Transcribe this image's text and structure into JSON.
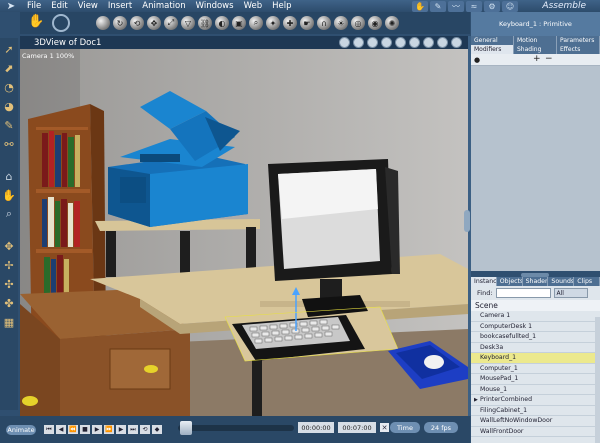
{
  "menubar": {
    "logo_icon": "poser-arrow-icon",
    "items": [
      "File",
      "Edit",
      "View",
      "Insert",
      "Animation",
      "Windows",
      "Web",
      "Help"
    ],
    "room": "Assemble"
  },
  "viewport": {
    "title": "3DView of Doc1",
    "camera_label": "Camera 1  100%"
  },
  "timeline": {
    "animate_label": "Animate",
    "current_time": "00:00:00",
    "end_time": "00:07:00",
    "time_mode": "Time",
    "fps": "24 fps"
  },
  "properties": {
    "title": "Keyboard_1 : Primitive",
    "tabs_row1": [
      "General",
      "Motion",
      "Parameters"
    ],
    "tabs_row2": [
      "Modifiers",
      "Shading",
      "Effects"
    ],
    "active_tab": "Modifiers"
  },
  "library": {
    "tabs": [
      "Instances",
      "Objects",
      "Shaders",
      "Sounds",
      "Clips"
    ],
    "active_tab": "Instances",
    "find_label": "Find:",
    "filter_value": "All",
    "scene_label": "Scene",
    "items": [
      {
        "label": "Camera 1",
        "selected": false,
        "expandable": false
      },
      {
        "label": "ComputerDesk 1",
        "selected": false,
        "expandable": false
      },
      {
        "label": "bookcasefullted_1",
        "selected": false,
        "expandable": false
      },
      {
        "label": "Desk3a",
        "selected": false,
        "expandable": false
      },
      {
        "label": "Keyboard_1",
        "selected": true,
        "expandable": false
      },
      {
        "label": "Computer_1",
        "selected": false,
        "expandable": false
      },
      {
        "label": "MousePad_1",
        "selected": false,
        "expandable": false
      },
      {
        "label": "Mouse_1",
        "selected": false,
        "expandable": false
      },
      {
        "label": "PrinterCombined",
        "selected": false,
        "expandable": true
      },
      {
        "label": "FilingCabinet_1",
        "selected": false,
        "expandable": false
      },
      {
        "label": "WallLeftNoWindowDoor",
        "selected": false,
        "expandable": false
      },
      {
        "label": "WallFrontDoor",
        "selected": false,
        "expandable": false
      }
    ]
  }
}
